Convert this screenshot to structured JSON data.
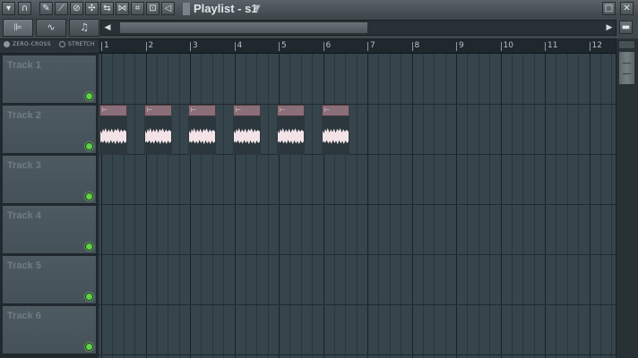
{
  "window": {
    "title": "Playlist - s1"
  },
  "options": {
    "zero_cross": "ZERO-CROSS",
    "stretch": "STRETCH"
  },
  "ruler": {
    "bars": [
      "1",
      "2",
      "3",
      "4",
      "5",
      "6",
      "7",
      "8",
      "9",
      "10",
      "11",
      "12"
    ]
  },
  "tracks": [
    {
      "name": "Track 1"
    },
    {
      "name": "Track 2"
    },
    {
      "name": "Track 3"
    },
    {
      "name": "Track 4"
    },
    {
      "name": "Track 5"
    },
    {
      "name": "Track 6"
    }
  ],
  "clips": {
    "track": 2,
    "count": 6
  },
  "colors": {
    "clip_header": "#8a6e78",
    "waveform": "#f3e3e7",
    "mute_led": "#61d14a"
  }
}
